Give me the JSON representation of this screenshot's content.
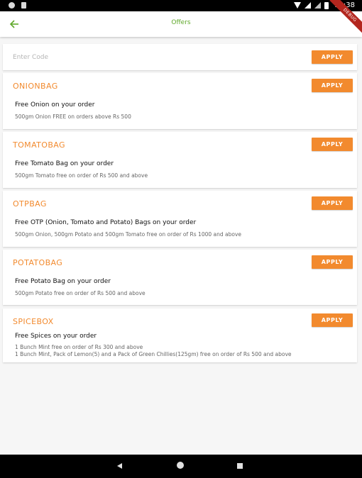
{
  "status_bar": {
    "time": "11:38"
  },
  "app_bar": {
    "title": "Offers",
    "debug_label": "DEBUG"
  },
  "code_entry": {
    "placeholder": "Enter Code",
    "value": "",
    "apply_label": "APPLY"
  },
  "offers": [
    {
      "code": "ONIONBAG",
      "title": "Free Onion on your order",
      "description": "500gm Onion FREE on orders above Rs 500",
      "apply_label": "APPLY"
    },
    {
      "code": "TOMATOBAG",
      "title": "Free Tomato Bag on your order",
      "description": "500gm Tomato free on order of Rs 500 and above",
      "apply_label": "APPLY"
    },
    {
      "code": "OTPBAG",
      "title": "Free OTP (Onion, Tomato and Potato) Bags on your order",
      "description": "500gm Onion, 500gm Potato and 500gm Tomato free on order of Rs 1000 and above",
      "apply_label": "APPLY"
    },
    {
      "code": "POTATOBAG",
      "title": "Free Potato Bag on your order",
      "description": "500gm Potato free on order of Rs 500 and above",
      "apply_label": "APPLY"
    },
    {
      "code": "SPICEBOX",
      "title": "Free Spices on your order",
      "description": "1 Bunch Mint free on order of Rs 300 and above\n1 Bunch Mint, Pack of Lemon(5) and a Pack of Green Chillies(125gm) free on order of Rs 500 and above",
      "apply_label": "APPLY"
    }
  ],
  "colors": {
    "accent": "#f28a2e",
    "title_green": "#5fa82a"
  }
}
